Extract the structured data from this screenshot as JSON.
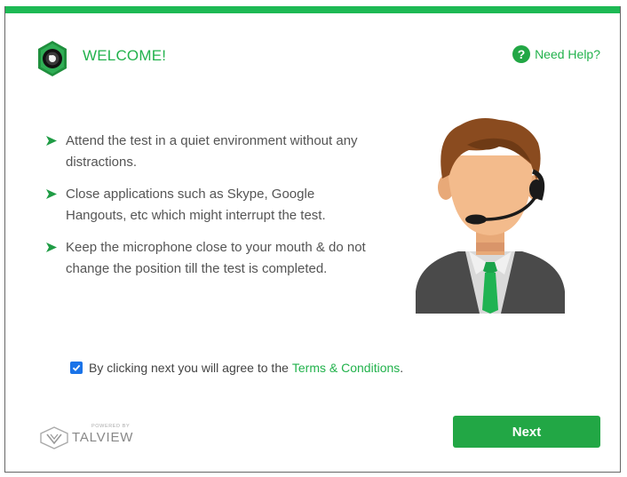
{
  "header": {
    "title": "WELCOME!",
    "help_label": "Need Help?",
    "help_icon_glyph": "?"
  },
  "instructions": [
    {
      "text": "Attend the test in a quiet environment without any distractions."
    },
    {
      "text": "Close applications such as Skype, Google Hangouts, etc which might interrupt the test."
    },
    {
      "text": "Keep the microphone close to your mouth & do not change the position till the test is completed."
    }
  ],
  "agreement": {
    "checked": true,
    "text": "By clicking next you will agree to the",
    "link_text": "Terms & Conditions",
    "suffix": "."
  },
  "branding": {
    "powered_by": "POWERED BY",
    "name": "TALVIEW"
  },
  "actions": {
    "next_label": "Next"
  },
  "colors": {
    "accent": "#22b24c",
    "button": "#22a745",
    "checkbox": "#1a73e8"
  },
  "icons": {
    "logo": "camera-lens-hexagon-icon",
    "help": "question-circle-icon",
    "bullet": "arrow-bullet-icon"
  }
}
